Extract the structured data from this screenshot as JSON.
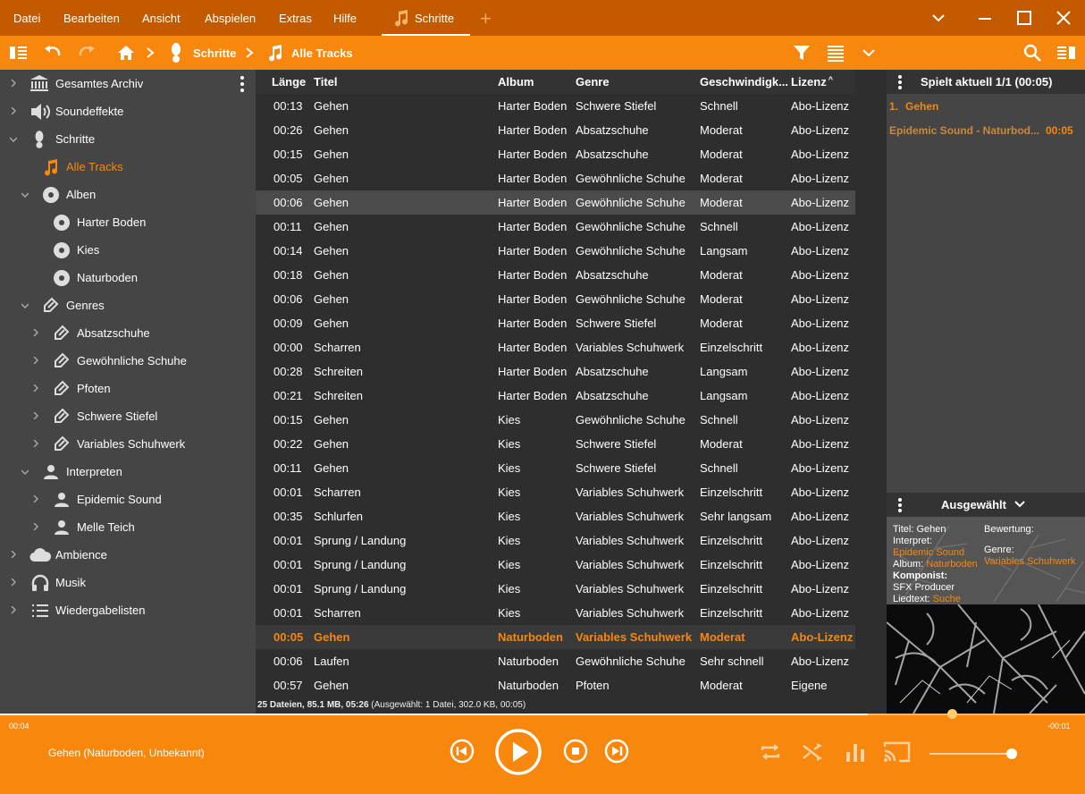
{
  "menu": {
    "items": [
      "Datei",
      "Bearbeiten",
      "Ansicht",
      "Abspielen",
      "Extras",
      "Hilfe"
    ],
    "tab_label": "Schritte",
    "add_tab": "+"
  },
  "toolbar": {
    "crumb1": "Schritte",
    "crumb2": "Alle Tracks"
  },
  "sidebar": {
    "gesamtes_archiv": "Gesamtes Archiv",
    "soundeffekte": "Soundeffekte",
    "schritte": "Schritte",
    "alle_tracks": "Alle Tracks",
    "alben": "Alben",
    "alben_items": [
      "Harter Boden",
      "Kies",
      "Naturboden"
    ],
    "genres": "Genres",
    "genre_items": [
      "Absatzschuhe",
      "Gewöhnliche Schuhe",
      "Pfoten",
      "Schwere Stiefel",
      "Variables Schuhwerk"
    ],
    "interpreten": "Interpreten",
    "interpret_items": [
      "Epidemic Sound",
      "Melle Teich"
    ],
    "ambience": "Ambience",
    "musik": "Musik",
    "wiedergabelisten": "Wiedergabelisten"
  },
  "table": {
    "columns": [
      "Länge",
      "Titel",
      "Album",
      "Genre",
      "Geschwindigk...",
      "Lizenz"
    ],
    "sort_indicator": "^",
    "rows": [
      [
        "00:13",
        "Gehen",
        "Harter Boden",
        "Schwere Stiefel",
        "Schnell",
        "Abo-Lizenz"
      ],
      [
        "00:26",
        "Gehen",
        "Harter Boden",
        "Absatzschuhe",
        "Moderat",
        "Abo-Lizenz"
      ],
      [
        "00:15",
        "Gehen",
        "Harter Boden",
        "Absatzschuhe",
        "Moderat",
        "Abo-Lizenz"
      ],
      [
        "00:05",
        "Gehen",
        "Harter Boden",
        "Gewöhnliche Schuhe",
        "Moderat",
        "Abo-Lizenz"
      ],
      [
        "00:06",
        "Gehen",
        "Harter Boden",
        "Gewöhnliche Schuhe",
        "Moderat",
        "Abo-Lizenz"
      ],
      [
        "00:11",
        "Gehen",
        "Harter Boden",
        "Gewöhnliche Schuhe",
        "Schnell",
        "Abo-Lizenz"
      ],
      [
        "00:14",
        "Gehen",
        "Harter Boden",
        "Gewöhnliche Schuhe",
        "Langsam",
        "Abo-Lizenz"
      ],
      [
        "00:18",
        "Gehen",
        "Harter Boden",
        "Absatzschuhe",
        "Moderat",
        "Abo-Lizenz"
      ],
      [
        "00:06",
        "Gehen",
        "Harter Boden",
        "Gewöhnliche Schuhe",
        "Moderat",
        "Abo-Lizenz"
      ],
      [
        "00:09",
        "Gehen",
        "Harter Boden",
        "Schwere Stiefel",
        "Moderat",
        "Abo-Lizenz"
      ],
      [
        "00:00",
        "Scharren",
        "Harter Boden",
        "Variables Schuhwerk",
        "Einzelschritt",
        "Abo-Lizenz"
      ],
      [
        "00:28",
        "Schreiten",
        "Harter Boden",
        "Absatzschuhe",
        "Langsam",
        "Abo-Lizenz"
      ],
      [
        "00:21",
        "Schreiten",
        "Harter Boden",
        "Absatzschuhe",
        "Langsam",
        "Abo-Lizenz"
      ],
      [
        "00:15",
        "Gehen",
        "Kies",
        "Gewöhnliche Schuhe",
        "Schnell",
        "Abo-Lizenz"
      ],
      [
        "00:22",
        "Gehen",
        "Kies",
        "Schwere Stiefel",
        "Moderat",
        "Abo-Lizenz"
      ],
      [
        "00:11",
        "Gehen",
        "Kies",
        "Schwere Stiefel",
        "Schnell",
        "Abo-Lizenz"
      ],
      [
        "00:01",
        "Scharren",
        "Kies",
        "Variables Schuhwerk",
        "Einzelschritt",
        "Abo-Lizenz"
      ],
      [
        "00:35",
        "Schlurfen",
        "Kies",
        "Variables Schuhwerk",
        "Sehr langsam",
        "Abo-Lizenz"
      ],
      [
        "00:01",
        "Sprung / Landung",
        "Kies",
        "Variables Schuhwerk",
        "Einzelschritt",
        "Abo-Lizenz"
      ],
      [
        "00:01",
        "Sprung / Landung",
        "Kies",
        "Variables Schuhwerk",
        "Einzelschritt",
        "Abo-Lizenz"
      ],
      [
        "00:01",
        "Sprung / Landung",
        "Kies",
        "Variables Schuhwerk",
        "Einzelschritt",
        "Abo-Lizenz"
      ],
      [
        "00:01",
        "Scharren",
        "Kies",
        "Variables Schuhwerk",
        "Einzelschritt",
        "Abo-Lizenz"
      ],
      [
        "00:05",
        "Gehen",
        "Naturboden",
        "Variables Schuhwerk",
        "Moderat",
        "Abo-Lizenz"
      ],
      [
        "00:06",
        "Laufen",
        "Naturboden",
        "Gewöhnliche Schuhe",
        "Sehr schnell",
        "Abo-Lizenz"
      ],
      [
        "00:57",
        "Gehen",
        "Naturboden",
        "Pfoten",
        "Moderat",
        "Eigene"
      ]
    ],
    "selected_row": 4,
    "playing_row": 22,
    "status_bold": "25 Dateien, 85.1 MB, 05:26",
    "status_rest": "(Ausgewählt: 1 Datei, 302.0 KB, 00:05)"
  },
  "nowplaying": {
    "title": "Spielt aktuell 1/1 (00:05)",
    "item_index": "1.",
    "item_title": "Gehen",
    "item_sub": "Epidemic Sound - Naturbod...",
    "item_time": "00:05"
  },
  "selected": {
    "title": "Ausgewählt",
    "titel_label": "Titel:",
    "titel_value": "Gehen",
    "interpret_label": "Interpret:",
    "interpret_value": "Epidemic Sound",
    "album_label": "Album:",
    "album_value": "Naturboden",
    "komponist_label": "Komponist:",
    "komponist_value": "SFX Producer",
    "liedtext_label": "Liedtext:",
    "liedtext_value": "Suche",
    "bewertung_label": "Bewertung:",
    "genre_label": "Genre:",
    "genre_value": "Variables Schuhwerk"
  },
  "player": {
    "elapsed": "00:04",
    "remaining": "-00:01",
    "track": "Gehen (Naturboden, Unbekannt)",
    "progress": 0.8,
    "volume": 1.0
  },
  "colors": {
    "accent": "#f7870d",
    "menubar": "#c35a00",
    "sidebar": "#454545",
    "content": "#2e2e2e"
  }
}
